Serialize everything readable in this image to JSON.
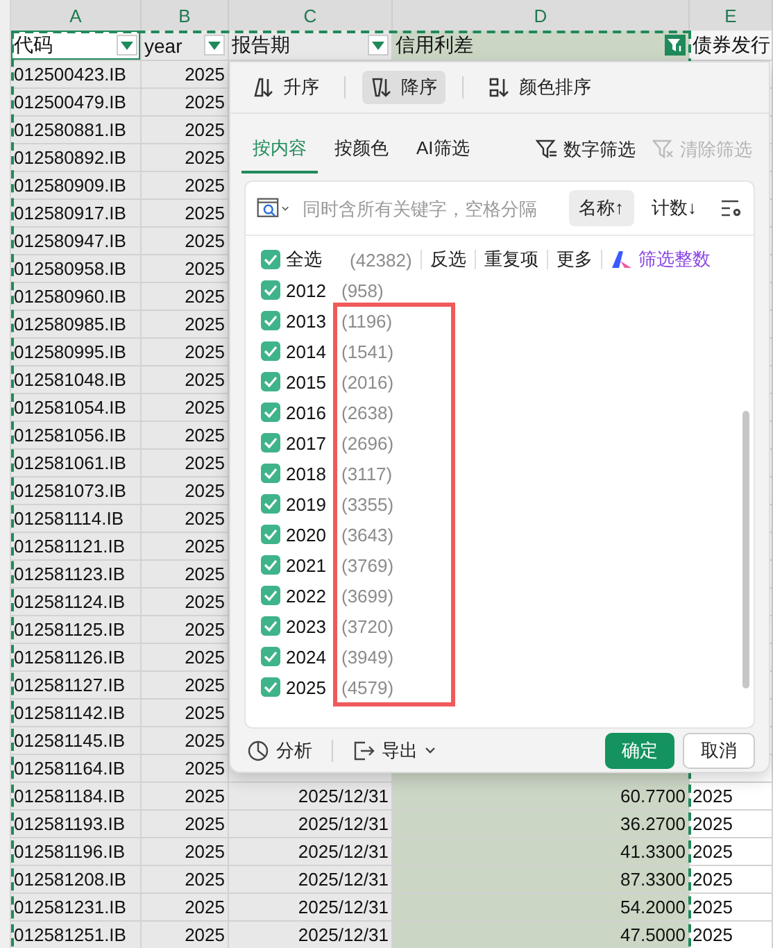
{
  "columns": [
    {
      "letter": "A"
    },
    {
      "letter": "B"
    },
    {
      "letter": "C"
    },
    {
      "letter": "D"
    },
    {
      "letter": "E"
    }
  ],
  "header": [
    {
      "label": "代码",
      "kind": "dropdown",
      "active": true
    },
    {
      "label": "year",
      "kind": "dropdown",
      "active": false
    },
    {
      "label": "报告期",
      "kind": "dropdown",
      "active": false
    },
    {
      "label": "信用利差",
      "kind": "applied",
      "active": false
    },
    {
      "label": "债券发行",
      "kind": "plain",
      "active": false
    }
  ],
  "rows": [
    {
      "code": "012500423.IB",
      "year": "2025"
    },
    {
      "code": "012500479.IB",
      "year": "2025"
    },
    {
      "code": "012580881.IB",
      "year": "2025"
    },
    {
      "code": "012580892.IB",
      "year": "2025"
    },
    {
      "code": "012580909.IB",
      "year": "2025"
    },
    {
      "code": "012580917.IB",
      "year": "2025"
    },
    {
      "code": "012580947.IB",
      "year": "2025"
    },
    {
      "code": "012580958.IB",
      "year": "2025"
    },
    {
      "code": "012580960.IB",
      "year": "2025"
    },
    {
      "code": "012580985.IB",
      "year": "2025"
    },
    {
      "code": "012580995.IB",
      "year": "2025"
    },
    {
      "code": "012581048.IB",
      "year": "2025"
    },
    {
      "code": "012581054.IB",
      "year": "2025"
    },
    {
      "code": "012581056.IB",
      "year": "2025"
    },
    {
      "code": "012581061.IB",
      "year": "2025"
    },
    {
      "code": "012581073.IB",
      "year": "2025"
    },
    {
      "code": "012581114.IB",
      "year": "2025"
    },
    {
      "code": "012581121.IB",
      "year": "2025"
    },
    {
      "code": "012581123.IB",
      "year": "2025"
    },
    {
      "code": "012581124.IB",
      "year": "2025"
    },
    {
      "code": "012581125.IB",
      "year": "2025"
    },
    {
      "code": "012581126.IB",
      "year": "2025"
    },
    {
      "code": "012581127.IB",
      "year": "2025"
    },
    {
      "code": "012581142.IB",
      "year": "2025"
    },
    {
      "code": "012581145.IB",
      "year": "2025"
    },
    {
      "code": "012581164.IB",
      "year": "2025"
    },
    {
      "code": "012581184.IB",
      "year": "2025",
      "date": "2025/12/31",
      "spread": "60.7700",
      "e": "2025"
    },
    {
      "code": "012581193.IB",
      "year": "2025",
      "date": "2025/12/31",
      "spread": "36.2700",
      "e": "2025"
    },
    {
      "code": "012581196.IB",
      "year": "2025",
      "date": "2025/12/31",
      "spread": "41.3300",
      "e": "2025"
    },
    {
      "code": "012581208.IB",
      "year": "2025",
      "date": "2025/12/31",
      "spread": "87.3300",
      "e": "2025"
    },
    {
      "code": "012581231.IB",
      "year": "2025",
      "date": "2025/12/31",
      "spread": "54.2000",
      "e": "2025"
    },
    {
      "code": "012581251.IB",
      "year": "2025",
      "date": "2025/12/31",
      "spread": "47.5000",
      "e": "2025"
    }
  ],
  "filter_popup": {
    "sort_buttons": [
      {
        "label": "升序",
        "selected": false
      },
      {
        "label": "降序",
        "selected": true
      },
      {
        "label": "颜色排序",
        "selected": false
      }
    ],
    "tabs": [
      {
        "label": "按内容",
        "selected": true
      },
      {
        "label": "按颜色",
        "selected": false
      },
      {
        "label": "AI筛选",
        "selected": false
      }
    ],
    "actions": [
      {
        "label": "数字筛选",
        "disabled": false
      },
      {
        "label": "清除筛选",
        "disabled": true
      }
    ],
    "search": {
      "placeholder": "同时含所有关键字，空格分隔"
    },
    "list_sort": [
      {
        "label": "名称↑",
        "selected": true
      },
      {
        "label": "计数↓",
        "selected": false
      }
    ],
    "select_all": {
      "label": "全选",
      "count": "(42382)",
      "checked": true
    },
    "links": [
      "反选",
      "重复项",
      "更多"
    ],
    "smart_filter": {
      "label": "筛选整数"
    },
    "items": [
      {
        "label": "2012",
        "count": "(958)",
        "checked": true,
        "highlighted": false
      },
      {
        "label": "2013",
        "count": "(1196)",
        "checked": true,
        "highlighted": true
      },
      {
        "label": "2014",
        "count": "(1541)",
        "checked": true,
        "highlighted": true
      },
      {
        "label": "2015",
        "count": "(2016)",
        "checked": true,
        "highlighted": true
      },
      {
        "label": "2016",
        "count": "(2638)",
        "checked": true,
        "highlighted": true
      },
      {
        "label": "2017",
        "count": "(2696)",
        "checked": true,
        "highlighted": true
      },
      {
        "label": "2018",
        "count": "(3117)",
        "checked": true,
        "highlighted": true
      },
      {
        "label": "2019",
        "count": "(3355)",
        "checked": true,
        "highlighted": true
      },
      {
        "label": "2020",
        "count": "(3643)",
        "checked": true,
        "highlighted": true
      },
      {
        "label": "2021",
        "count": "(3769)",
        "checked": true,
        "highlighted": true
      },
      {
        "label": "2022",
        "count": "(3699)",
        "checked": true,
        "highlighted": true
      },
      {
        "label": "2023",
        "count": "(3720)",
        "checked": true,
        "highlighted": true
      },
      {
        "label": "2024",
        "count": "(3949)",
        "checked": true,
        "highlighted": true
      },
      {
        "label": "2025",
        "count": "(4579)",
        "checked": true,
        "highlighted": true
      }
    ],
    "footer": {
      "analyze": "分析",
      "export": "导出",
      "ok": "确定",
      "cancel": "取消"
    }
  }
}
